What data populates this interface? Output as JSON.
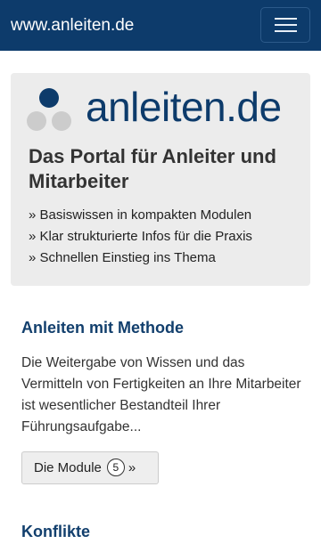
{
  "navbar": {
    "brand": "www.anleiten.de",
    "menu_icon": "hamburger-menu-icon"
  },
  "hero": {
    "logo_text": "anleiten.de",
    "logo_icon": "dots-logo-icon",
    "tagline": "Das Portal für Anleiter und Mitarbeiter",
    "features": [
      "» Basiswissen in kompakten Modulen",
      "» Klar strukturierte Infos für die Praxis",
      "» Schnellen Einstieg ins Thema"
    ]
  },
  "sections": [
    {
      "title": "Anleiten mit Methode",
      "body": "Die Weitergabe von Wissen und das Vermitteln von Fertigkeiten an Ihre Mitarbeiter ist wesentlicher Bestandteil Ihrer Führungsaufgabe...",
      "button": {
        "label": "Die Module",
        "count": "5",
        "arrow": "»"
      }
    },
    {
      "title": "Konflikte"
    }
  ],
  "colors": {
    "navbar_bg": "#0d3b6b",
    "brand_blue": "#0d3b6b",
    "heading_blue": "#123f6d",
    "logo_gray": "#cccccc",
    "hero_bg": "#ececec"
  }
}
